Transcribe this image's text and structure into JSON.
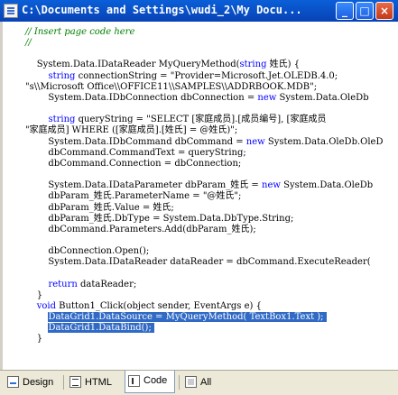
{
  "window": {
    "title": "C:\\Documents and Settings\\wudi_2\\My Docu...",
    "controls": {
      "minimize": "_",
      "maximize": "□",
      "close": "×"
    }
  },
  "code": [
    {
      "text": "// Insert page code here",
      "type": "comment"
    },
    {
      "text": "//",
      "type": "comment"
    },
    {
      "text": "",
      "type": "plain"
    },
    {
      "text": "    System.Data.IDataReader MyQueryMethod(string 姓氏) {",
      "type": "plain"
    },
    {
      "text": "        string connectionString = \"Provider=Microsoft.Jet.OLEDB.4.0;",
      "type": "plain"
    },
    {
      "text": "\"s\\\\Microsoft Office\\\\OFFICE11\\\\SAMPLES\\\\ADDRBOOK.MDB\";",
      "type": "plain"
    },
    {
      "text": "        System.Data.IDbConnection dbConnection = new System.Data.OleDb",
      "type": "plain"
    },
    {
      "text": "",
      "type": "plain"
    },
    {
      "text": "        string queryString = \"SELECT [家庭成员].[成员编号], [家庭成员",
      "type": "plain"
    },
    {
      "text": "\"家庭成员] WHERE ([家庭成员].[姓氏] = @姓氏)\";",
      "type": "plain"
    },
    {
      "text": "        System.Data.IDbCommand dbCommand = new System.Data.OleDb.OleD",
      "type": "plain"
    },
    {
      "text": "        dbCommand.CommandText = queryString;",
      "type": "plain"
    },
    {
      "text": "        dbCommand.Connection = dbConnection;",
      "type": "plain"
    },
    {
      "text": "",
      "type": "plain"
    },
    {
      "text": "        System.Data.IDataParameter dbParam_姓氏 = new System.Data.OleDb",
      "type": "plain"
    },
    {
      "text": "        dbParam_姓氏.ParameterName = \"@姓氏\";",
      "type": "plain"
    },
    {
      "text": "        dbParam_姓氏.Value = 姓氏;",
      "type": "plain"
    },
    {
      "text": "        dbParam_姓氏.DbType = System.Data.DbType.String;",
      "type": "plain"
    },
    {
      "text": "        dbCommand.Parameters.Add(dbParam_姓氏);",
      "type": "plain"
    },
    {
      "text": "",
      "type": "plain"
    },
    {
      "text": "        dbConnection.Open();",
      "type": "plain"
    },
    {
      "text": "        System.Data.IDataReader dataReader = dbCommand.ExecuteReader(",
      "type": "plain"
    },
    {
      "text": "",
      "type": "plain"
    },
    {
      "text": "        return dataReader;",
      "type": "plain"
    },
    {
      "text": "    }",
      "type": "plain"
    },
    {
      "text": "    void Button1_Click(object sender, EventArgs e) {",
      "type": "plain"
    },
    {
      "text": "        DataGrid1.DataSource = MyQueryMethod( TextBox1.Text );",
      "type": "selected"
    },
    {
      "text": "        DataGrid1.DataBind();",
      "type": "selected"
    },
    {
      "text": "    }",
      "type": "plain"
    }
  ],
  "tabs": [
    {
      "label": "Design",
      "icon": "design-icon"
    },
    {
      "label": "HTML",
      "icon": "html-icon"
    },
    {
      "label": "Code",
      "icon": "code-icon"
    },
    {
      "label": "All",
      "icon": "all-icon"
    }
  ],
  "active_tab": "Code",
  "colors": {
    "selection": "#316ac5",
    "comment": "#008000",
    "titlebar": "#0a5fd8"
  }
}
